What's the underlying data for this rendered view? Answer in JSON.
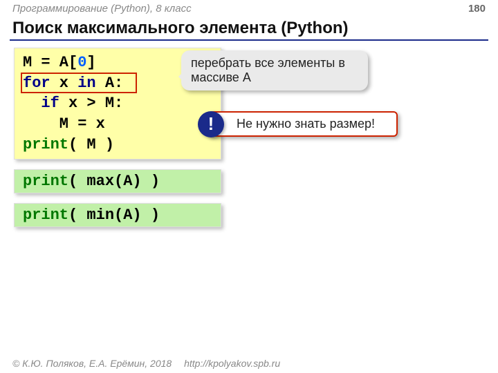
{
  "header": {
    "breadcrumb": "Программирование (Python), 8 класс",
    "page_number": "180"
  },
  "title": "Поиск максимального элемента (Python)",
  "code_main": {
    "l1_a": "M = A[",
    "l1_num": "0",
    "l1_b": "]",
    "l2_for": "for",
    "l2_x": " x ",
    "l2_in": "in",
    "l2_rest": " A:",
    "l3_if": "  if",
    "l3_rest": " x > M:",
    "l4": "    M = x ",
    "l5_print": "print",
    "l5_rest": "( M )"
  },
  "callout_grey": "перебрать все элементы в массиве A",
  "callout_red": "Не нужно знать размер!",
  "excl": "!",
  "code_max": {
    "print": "print",
    "rest": "( max(A) )"
  },
  "code_min": {
    "print": "print",
    "rest": "( min(A) )"
  },
  "footer": {
    "copyright": "© К.Ю. Поляков, Е.А. Ерёмин, 2018",
    "url": "http://kpolyakov.spb.ru"
  }
}
